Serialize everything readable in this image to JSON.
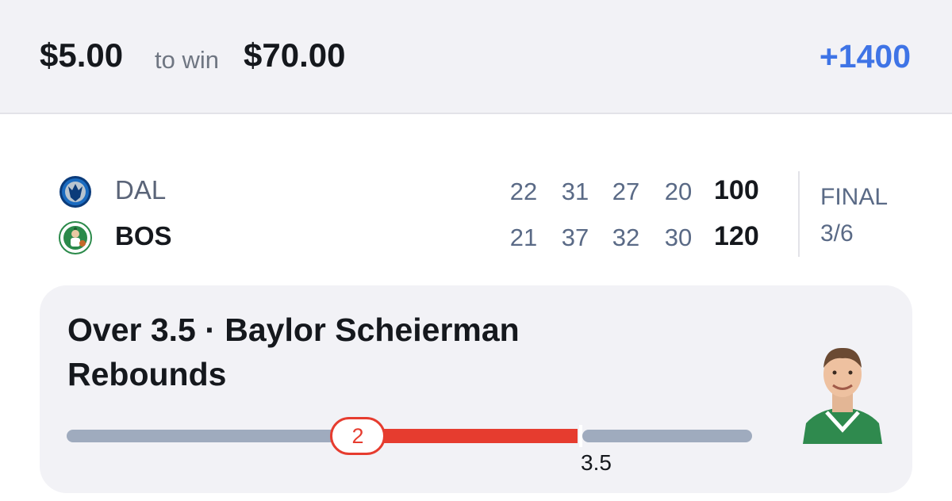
{
  "header": {
    "stake": "$5.00",
    "to_win_label": "to win",
    "payout": "$70.00",
    "odds": "+1400",
    "accent_color": "#3f74e6"
  },
  "game": {
    "teams": [
      {
        "abbr": "DAL",
        "logo_icon": "mavericks-logo-icon",
        "quarters": [
          "22",
          "31",
          "27",
          "20"
        ],
        "total": "100"
      },
      {
        "abbr": "BOS",
        "logo_icon": "celtics-logo-icon",
        "quarters": [
          "21",
          "37",
          "32",
          "30"
        ],
        "total": "120"
      }
    ],
    "status": "FINAL",
    "date": "3/6"
  },
  "prop": {
    "title": "Over 3.5 · Baylor Scheierman Rebounds",
    "current_value": "2",
    "line_value": "3.5",
    "progress_fraction_of_line": 0.57,
    "player_icon": "player-headshot-icon",
    "loss_color": "#e63c2f"
  }
}
